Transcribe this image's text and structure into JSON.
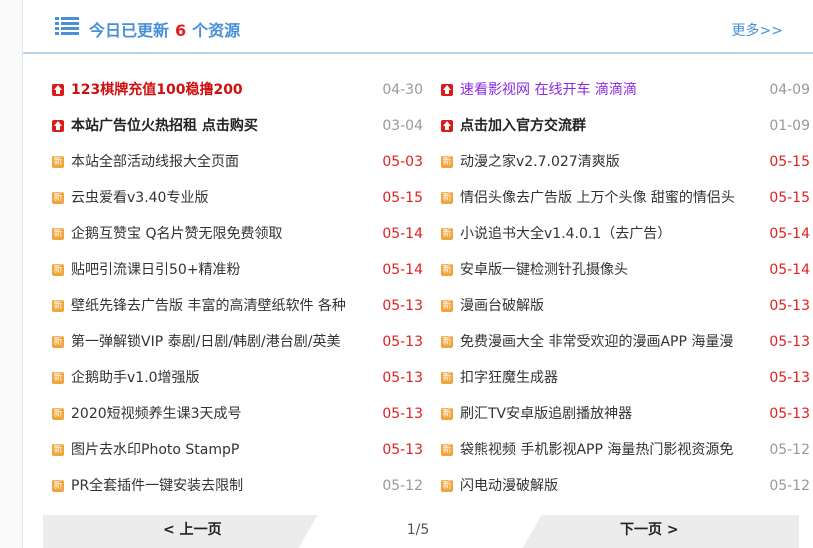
{
  "header": {
    "title_prefix": "今日已更新",
    "count": "6",
    "title_suffix": "个资源",
    "more": "更多>>",
    "accent": "#4a90d9"
  },
  "left_items": [
    {
      "icon": "top",
      "title": "123棋牌充值100稳撸200",
      "style": "bold red",
      "date": "04-30",
      "date_hot": false
    },
    {
      "icon": "top",
      "title": "本站广告位火热招租 点击购买",
      "style": "bold dark",
      "date": "03-04",
      "date_hot": false
    },
    {
      "icon": "new",
      "title": "本站全部活动线报大全页面",
      "style": "",
      "date": "05-03",
      "date_hot": true
    },
    {
      "icon": "new",
      "title": "云虫爱看v3.40专业版",
      "style": "",
      "date": "05-15",
      "date_hot": true
    },
    {
      "icon": "new",
      "title": "企鹅互赞宝 Q名片赞无限免费领取",
      "style": "",
      "date": "05-14",
      "date_hot": true
    },
    {
      "icon": "new",
      "title": "贴吧引流课日引50+精准粉",
      "style": "",
      "date": "05-14",
      "date_hot": true
    },
    {
      "icon": "new",
      "title": "壁纸先锋去广告版 丰富的高清壁纸软件 各种",
      "style": "",
      "date": "05-13",
      "date_hot": true
    },
    {
      "icon": "new",
      "title": "第一弹解锁VIP 泰剧/日剧/韩剧/港台剧/英美",
      "style": "",
      "date": "05-13",
      "date_hot": true
    },
    {
      "icon": "new",
      "title": "企鹅助手v1.0增强版",
      "style": "",
      "date": "05-13",
      "date_hot": true
    },
    {
      "icon": "new",
      "title": "2020短视频养生课3天成号",
      "style": "",
      "date": "05-13",
      "date_hot": true
    },
    {
      "icon": "new",
      "title": "图片去水印Photo StampP",
      "style": "",
      "date": "05-13",
      "date_hot": true
    },
    {
      "icon": "new",
      "title": "PR全套插件一键安装去限制",
      "style": "",
      "date": "05-12",
      "date_hot": false
    }
  ],
  "right_items": [
    {
      "icon": "top",
      "title": "速看影视网 在线开车 滴滴滴",
      "style": "purple",
      "date": "04-09",
      "date_hot": false
    },
    {
      "icon": "top",
      "title": "点击加入官方交流群",
      "style": "bold dark",
      "date": "01-09",
      "date_hot": false
    },
    {
      "icon": "new",
      "title": "动漫之家v2.7.027清爽版",
      "style": "",
      "date": "05-15",
      "date_hot": true
    },
    {
      "icon": "new",
      "title": "情侣头像去广告版 上万个头像 甜蜜的情侣头",
      "style": "",
      "date": "05-15",
      "date_hot": true
    },
    {
      "icon": "new",
      "title": "小说追书大全v1.4.0.1（去广告）",
      "style": "",
      "date": "05-14",
      "date_hot": true
    },
    {
      "icon": "new",
      "title": "安卓版一键检测针孔摄像头",
      "style": "",
      "date": "05-14",
      "date_hot": true
    },
    {
      "icon": "new",
      "title": "漫画台破解版",
      "style": "",
      "date": "05-13",
      "date_hot": true
    },
    {
      "icon": "new",
      "title": "免费漫画大全 非常受欢迎的漫画APP 海量漫",
      "style": "",
      "date": "05-13",
      "date_hot": true
    },
    {
      "icon": "new",
      "title": "扣字狂魔生成器",
      "style": "",
      "date": "05-13",
      "date_hot": true
    },
    {
      "icon": "new",
      "title": "刷汇TV安卓版追剧播放神器",
      "style": "",
      "date": "05-13",
      "date_hot": true
    },
    {
      "icon": "new",
      "title": "袋熊视频 手机影视APP 海量热门影视资源免",
      "style": "",
      "date": "05-12",
      "date_hot": false
    },
    {
      "icon": "new",
      "title": "闪电动漫破解版",
      "style": "",
      "date": "05-12",
      "date_hot": false
    }
  ],
  "new_badge": "新",
  "pager": {
    "prev": "< 上一页",
    "page": "1/5",
    "next": "下一页 >"
  }
}
